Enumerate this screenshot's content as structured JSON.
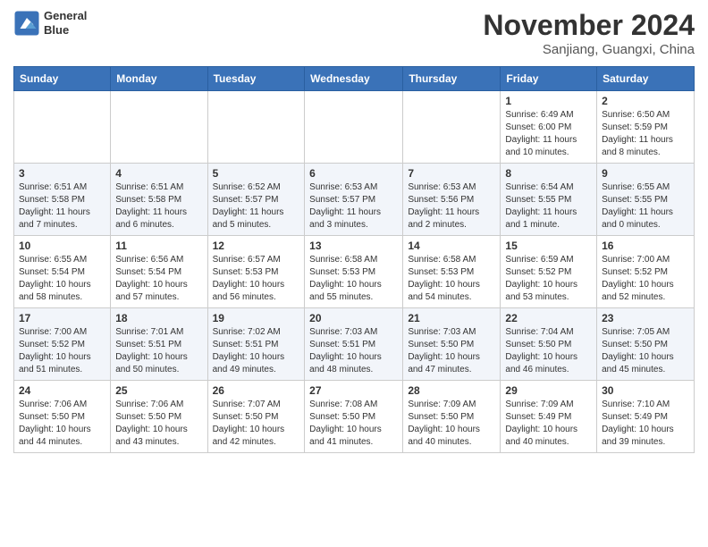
{
  "header": {
    "logo_line1": "General",
    "logo_line2": "Blue",
    "month": "November 2024",
    "location": "Sanjiang, Guangxi, China"
  },
  "weekdays": [
    "Sunday",
    "Monday",
    "Tuesday",
    "Wednesday",
    "Thursday",
    "Friday",
    "Saturday"
  ],
  "weeks": [
    [
      {
        "day": "",
        "info": ""
      },
      {
        "day": "",
        "info": ""
      },
      {
        "day": "",
        "info": ""
      },
      {
        "day": "",
        "info": ""
      },
      {
        "day": "",
        "info": ""
      },
      {
        "day": "1",
        "info": "Sunrise: 6:49 AM\nSunset: 6:00 PM\nDaylight: 11 hours and 10 minutes."
      },
      {
        "day": "2",
        "info": "Sunrise: 6:50 AM\nSunset: 5:59 PM\nDaylight: 11 hours and 8 minutes."
      }
    ],
    [
      {
        "day": "3",
        "info": "Sunrise: 6:51 AM\nSunset: 5:58 PM\nDaylight: 11 hours and 7 minutes."
      },
      {
        "day": "4",
        "info": "Sunrise: 6:51 AM\nSunset: 5:58 PM\nDaylight: 11 hours and 6 minutes."
      },
      {
        "day": "5",
        "info": "Sunrise: 6:52 AM\nSunset: 5:57 PM\nDaylight: 11 hours and 5 minutes."
      },
      {
        "day": "6",
        "info": "Sunrise: 6:53 AM\nSunset: 5:57 PM\nDaylight: 11 hours and 3 minutes."
      },
      {
        "day": "7",
        "info": "Sunrise: 6:53 AM\nSunset: 5:56 PM\nDaylight: 11 hours and 2 minutes."
      },
      {
        "day": "8",
        "info": "Sunrise: 6:54 AM\nSunset: 5:55 PM\nDaylight: 11 hours and 1 minute."
      },
      {
        "day": "9",
        "info": "Sunrise: 6:55 AM\nSunset: 5:55 PM\nDaylight: 11 hours and 0 minutes."
      }
    ],
    [
      {
        "day": "10",
        "info": "Sunrise: 6:55 AM\nSunset: 5:54 PM\nDaylight: 10 hours and 58 minutes."
      },
      {
        "day": "11",
        "info": "Sunrise: 6:56 AM\nSunset: 5:54 PM\nDaylight: 10 hours and 57 minutes."
      },
      {
        "day": "12",
        "info": "Sunrise: 6:57 AM\nSunset: 5:53 PM\nDaylight: 10 hours and 56 minutes."
      },
      {
        "day": "13",
        "info": "Sunrise: 6:58 AM\nSunset: 5:53 PM\nDaylight: 10 hours and 55 minutes."
      },
      {
        "day": "14",
        "info": "Sunrise: 6:58 AM\nSunset: 5:53 PM\nDaylight: 10 hours and 54 minutes."
      },
      {
        "day": "15",
        "info": "Sunrise: 6:59 AM\nSunset: 5:52 PM\nDaylight: 10 hours and 53 minutes."
      },
      {
        "day": "16",
        "info": "Sunrise: 7:00 AM\nSunset: 5:52 PM\nDaylight: 10 hours and 52 minutes."
      }
    ],
    [
      {
        "day": "17",
        "info": "Sunrise: 7:00 AM\nSunset: 5:52 PM\nDaylight: 10 hours and 51 minutes."
      },
      {
        "day": "18",
        "info": "Sunrise: 7:01 AM\nSunset: 5:51 PM\nDaylight: 10 hours and 50 minutes."
      },
      {
        "day": "19",
        "info": "Sunrise: 7:02 AM\nSunset: 5:51 PM\nDaylight: 10 hours and 49 minutes."
      },
      {
        "day": "20",
        "info": "Sunrise: 7:03 AM\nSunset: 5:51 PM\nDaylight: 10 hours and 48 minutes."
      },
      {
        "day": "21",
        "info": "Sunrise: 7:03 AM\nSunset: 5:50 PM\nDaylight: 10 hours and 47 minutes."
      },
      {
        "day": "22",
        "info": "Sunrise: 7:04 AM\nSunset: 5:50 PM\nDaylight: 10 hours and 46 minutes."
      },
      {
        "day": "23",
        "info": "Sunrise: 7:05 AM\nSunset: 5:50 PM\nDaylight: 10 hours and 45 minutes."
      }
    ],
    [
      {
        "day": "24",
        "info": "Sunrise: 7:06 AM\nSunset: 5:50 PM\nDaylight: 10 hours and 44 minutes."
      },
      {
        "day": "25",
        "info": "Sunrise: 7:06 AM\nSunset: 5:50 PM\nDaylight: 10 hours and 43 minutes."
      },
      {
        "day": "26",
        "info": "Sunrise: 7:07 AM\nSunset: 5:50 PM\nDaylight: 10 hours and 42 minutes."
      },
      {
        "day": "27",
        "info": "Sunrise: 7:08 AM\nSunset: 5:50 PM\nDaylight: 10 hours and 41 minutes."
      },
      {
        "day": "28",
        "info": "Sunrise: 7:09 AM\nSunset: 5:50 PM\nDaylight: 10 hours and 40 minutes."
      },
      {
        "day": "29",
        "info": "Sunrise: 7:09 AM\nSunset: 5:49 PM\nDaylight: 10 hours and 40 minutes."
      },
      {
        "day": "30",
        "info": "Sunrise: 7:10 AM\nSunset: 5:49 PM\nDaylight: 10 hours and 39 minutes."
      }
    ]
  ]
}
